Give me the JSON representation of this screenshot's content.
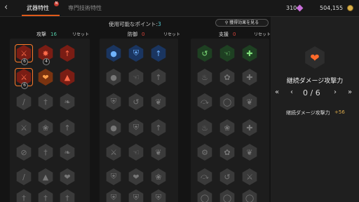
{
  "header": {
    "back_icon": "chevron-left-icon",
    "tabs": [
      {
        "label": "武器特性",
        "active": true,
        "badge": "N"
      },
      {
        "label": "専門技術特性",
        "active": false
      }
    ],
    "currencies": [
      {
        "value": "310",
        "icon": "gem-icon",
        "color": "#c96fd9"
      },
      {
        "value": "504,155",
        "icon": "coin-icon",
        "color": "#d9b04a"
      }
    ]
  },
  "points": {
    "label": "使用可能なポイント:",
    "value": "3"
  },
  "view_effects_button": "獲得効果を見る",
  "columns": [
    {
      "name": "攻撃",
      "value": "16",
      "reset": "リセット"
    },
    {
      "name": "防御",
      "value": "0",
      "reset": "リセット"
    },
    {
      "name": "支援",
      "value": "0",
      "reset": "リセット"
    }
  ],
  "detail": {
    "icon": "broken-heart-icon",
    "name": "継続ダメージ攻撃力",
    "level": "0 / 6",
    "stat_name": "継続ダメージ攻撃力",
    "stat_value": "+56"
  },
  "badges": [
    "6",
    "4",
    "6"
  ]
}
